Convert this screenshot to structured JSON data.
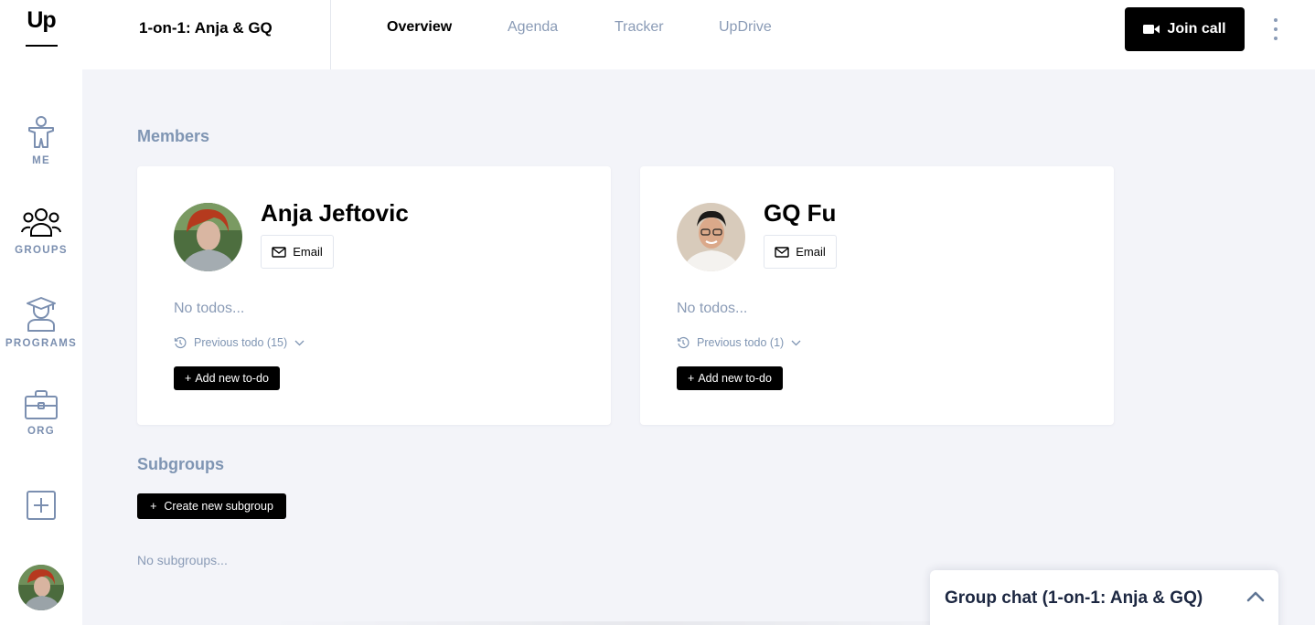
{
  "app": {
    "logo_text": "Up"
  },
  "sidebar": {
    "items": [
      {
        "label": "ME",
        "icon": "person-icon",
        "active": false
      },
      {
        "label": "GROUPS",
        "icon": "groups-icon",
        "active": true
      },
      {
        "label": "PROGRAMS",
        "icon": "graduate-icon",
        "active": false
      },
      {
        "label": "ORG",
        "icon": "briefcase-icon",
        "active": false
      }
    ],
    "add_icon": "plus-square-icon"
  },
  "header": {
    "group_title": "1-on-1: Anja & GQ",
    "tabs": [
      {
        "label": "Overview",
        "active": true
      },
      {
        "label": "Agenda",
        "active": false
      },
      {
        "label": "Tracker",
        "active": false
      },
      {
        "label": "UpDrive",
        "active": false
      }
    ],
    "join_call_label": "Join call"
  },
  "members": {
    "section_title": "Members",
    "cards": [
      {
        "name": "Anja Jeftovic",
        "email_label": "Email",
        "no_todos": "No todos...",
        "previous_todo": "Previous todo (15)",
        "add_todo_label": "Add new to-do"
      },
      {
        "name": "GQ Fu",
        "email_label": "Email",
        "no_todos": "No todos...",
        "previous_todo": "Previous todo (1)",
        "add_todo_label": "Add new to-do"
      }
    ]
  },
  "subgroups": {
    "section_title": "Subgroups",
    "create_label": "Create new subgroup",
    "empty_text": "No subgroups..."
  },
  "chat": {
    "title": "Group chat (1-on-1: Anja & GQ)"
  },
  "colors": {
    "accent": "#000000",
    "muted": "#8a9bb6",
    "section_title": "#7f95b3",
    "background": "#f3f4f9"
  }
}
